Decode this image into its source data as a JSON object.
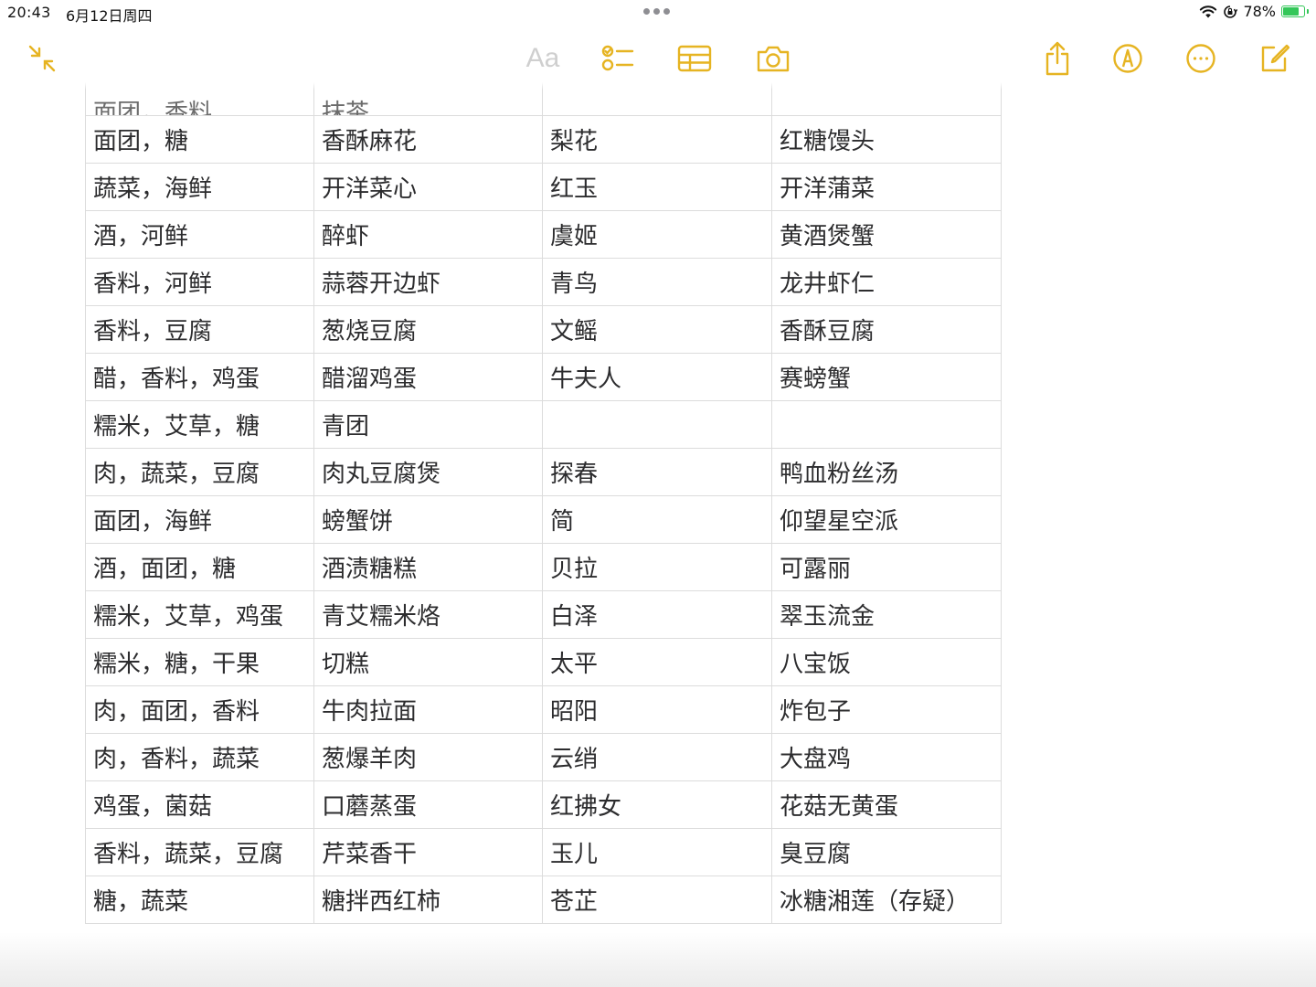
{
  "status_bar": {
    "time": "20:43",
    "date": "6月12日周四",
    "battery": "78%",
    "battery_level": 0.78
  },
  "toolbar": {
    "format_label": "Aa",
    "accent_color": "#e6b422",
    "icons": [
      "shrink-icon",
      "checklist-icon",
      "table-icon",
      "camera-icon",
      "share-icon",
      "markup-icon",
      "more-icon",
      "compose-icon"
    ]
  },
  "table": {
    "cut_row": [
      "面团，香料",
      "抹茶",
      "",
      ""
    ],
    "rows": [
      [
        "面团，糖",
        "香酥麻花",
        "梨花",
        "红糖馒头"
      ],
      [
        "蔬菜，海鲜",
        "开洋菜心",
        "红玉",
        "开洋蒲菜"
      ],
      [
        "酒，河鲜",
        "醉虾",
        "虞姬",
        "黄酒煲蟹"
      ],
      [
        "香料，河鲜",
        "蒜蓉开边虾",
        "青鸟",
        "龙井虾仁"
      ],
      [
        "香料，豆腐",
        "葱烧豆腐",
        "文鳐",
        "香酥豆腐"
      ],
      [
        "醋，香料，鸡蛋",
        "醋溜鸡蛋",
        "牛夫人",
        "赛螃蟹"
      ],
      [
        "糯米，艾草，糖",
        "青团",
        "",
        ""
      ],
      [
        "肉，蔬菜，豆腐",
        "肉丸豆腐煲",
        "探春",
        "鸭血粉丝汤"
      ],
      [
        "面团，海鲜",
        "螃蟹饼",
        "简",
        "仰望星空派"
      ],
      [
        "酒，面团，糖",
        "酒渍糖糕",
        "贝拉",
        "可露丽"
      ],
      [
        "糯米，艾草，鸡蛋",
        "青艾糯米烙",
        "白泽",
        "翠玉流金"
      ],
      [
        "糯米，糖，干果",
        "切糕",
        "太平",
        "八宝饭"
      ],
      [
        "肉，面团，香料",
        "牛肉拉面",
        "昭阳",
        "炸包子"
      ],
      [
        "肉，香料，蔬菜",
        "葱爆羊肉",
        "云绡",
        "大盘鸡"
      ],
      [
        "鸡蛋，菌菇",
        "口蘑蒸蛋",
        "红拂女",
        "花菇无黄蛋"
      ],
      [
        "香料，蔬菜，豆腐",
        "芹菜香干",
        "玉儿",
        "臭豆腐"
      ],
      [
        "糖，蔬菜",
        "糖拌西红柿",
        "苍芷",
        "冰糖湘莲（存疑）"
      ]
    ]
  }
}
